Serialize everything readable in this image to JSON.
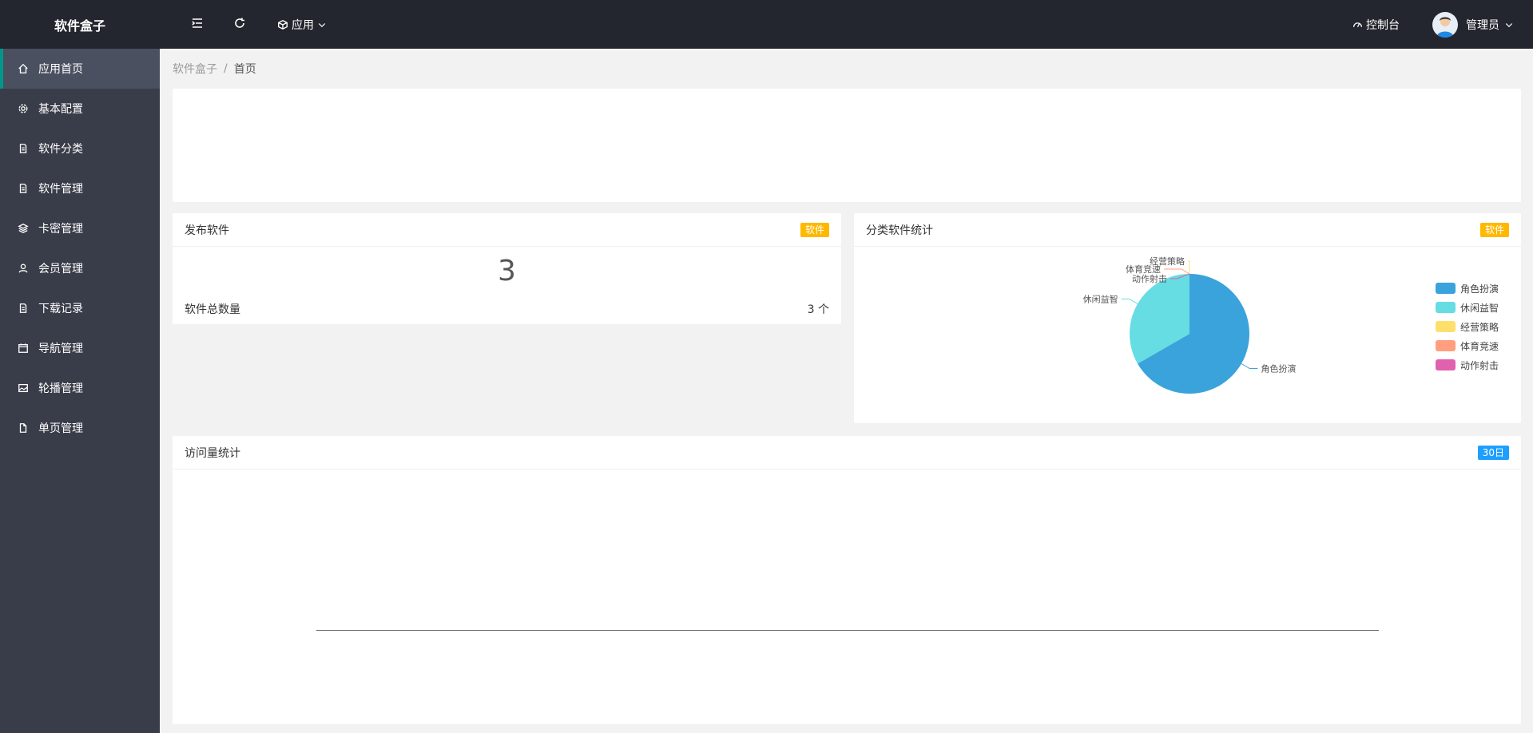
{
  "app": {
    "title": "软件盒子"
  },
  "sidebar": {
    "items": [
      {
        "label": "应用首页",
        "icon": "home-icon",
        "active": true
      },
      {
        "label": "基本配置",
        "icon": "gear-icon"
      },
      {
        "label": "软件分类",
        "icon": "document-icon"
      },
      {
        "label": "软件管理",
        "icon": "document-icon"
      },
      {
        "label": "卡密管理",
        "icon": "layers-icon"
      },
      {
        "label": "会员管理",
        "icon": "user-icon"
      },
      {
        "label": "下载记录",
        "icon": "document-icon"
      },
      {
        "label": "导航管理",
        "icon": "calendar-icon"
      },
      {
        "label": "轮播管理",
        "icon": "image-icon"
      },
      {
        "label": "单页管理",
        "icon": "file-icon"
      }
    ]
  },
  "header": {
    "app_menu": "应用",
    "console": "控制台",
    "user": "管理员"
  },
  "breadcrumb": {
    "root": "软件盒子",
    "separator": "/",
    "current": "首页"
  },
  "cards": {
    "publish": {
      "title": "发布软件",
      "badge": "软件",
      "count": "3",
      "label": "软件总数量",
      "value": "3 个"
    },
    "category": {
      "title": "分类软件统计",
      "badge": "软件"
    },
    "visits": {
      "title": "访问量统计",
      "badge": "30日"
    }
  },
  "chart_data": {
    "type": "pie",
    "title": "",
    "slices": [
      {
        "label": "角色扮演",
        "value": 2,
        "color": "#3aa3db"
      },
      {
        "label": "休闲益智",
        "value": 1,
        "color": "#66dde3"
      },
      {
        "label": "经营策略",
        "value": 0,
        "color": "#ffdf6b"
      },
      {
        "label": "体育竞速",
        "value": 0,
        "color": "#ff9f7f"
      },
      {
        "label": "动作射击",
        "value": 0,
        "color": "#e062ae"
      }
    ],
    "legend": "right"
  },
  "colors": {
    "sidebar_bg": "#393d49",
    "header_bg": "#23262e",
    "active_accent": "#009688",
    "badge_orange": "#ffb800",
    "badge_blue": "#1e9fff"
  }
}
